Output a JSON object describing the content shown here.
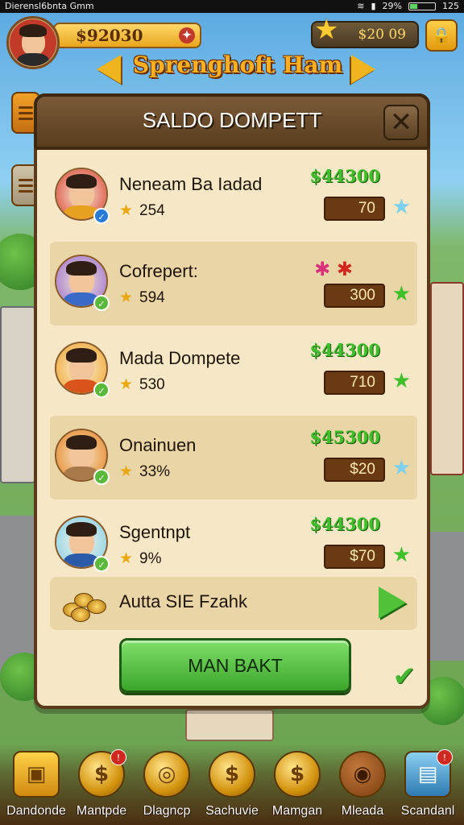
{
  "status_bar": {
    "left_text": "Dierensl6bnta Gmm",
    "battery_text": "29%",
    "time": "125"
  },
  "hud": {
    "coins": "$92030",
    "gems": "$20 09",
    "title": "Sprenghoft Ham"
  },
  "panel": {
    "title": "SALDO DOMPETT",
    "players": [
      {
        "name": "Neneam Ba Iadad",
        "rating": "254",
        "price": "$44300",
        "value": "70",
        "shirt": "#e8a020",
        "bg": "#d83a2a",
        "badge_color": "#2a7ad8",
        "fav_color": "#7ad0f0"
      },
      {
        "name": "Cofrepert:",
        "rating": "594",
        "price": "",
        "value": "300",
        "shirt": "#3a6ac8",
        "bg": "#9a6ad8",
        "badge_color": "#5ab83a",
        "fav_color": "#3fbf2a"
      },
      {
        "name": "Mada Dompete",
        "rating": "530",
        "price": "$44300",
        "value": "710",
        "shirt": "#d8541a",
        "bg": "#f0a020",
        "badge_color": "#5ab83a",
        "fav_color": "#3fbf2a"
      },
      {
        "name": "Onainuen",
        "rating": "33%",
        "price": "$45300",
        "value": "$20",
        "shirt": "#a87a4a",
        "bg": "#e8801a",
        "badge_color": "#5ab83a",
        "fav_color": "#7ad0f0"
      },
      {
        "name": "Sgentnpt",
        "rating": "9%",
        "price": "$44300",
        "value": "$70",
        "shirt": "#2a5aa8",
        "bg": "#7ad0f0",
        "badge_color": "#5ab83a",
        "fav_color": "#3fbf2a"
      }
    ],
    "bonus_label": "Autta SIE Fzahk",
    "main_button": "MAN BAKT"
  },
  "bottom_nav": [
    {
      "label": "Dandonde",
      "icon": "treasure-chest-icon"
    },
    {
      "label": "Mantpde",
      "icon": "dollar-coin-icon"
    },
    {
      "label": "Dlagncp",
      "icon": "coin-stack-icon"
    },
    {
      "label": "Sachuvie",
      "icon": "dollar-coin-icon"
    },
    {
      "label": "Mamgan",
      "icon": "dollar-coin-icon"
    },
    {
      "label": "Mleada",
      "icon": "barrel-icon"
    },
    {
      "label": "Scandanl",
      "icon": "gift-box-icon"
    }
  ]
}
